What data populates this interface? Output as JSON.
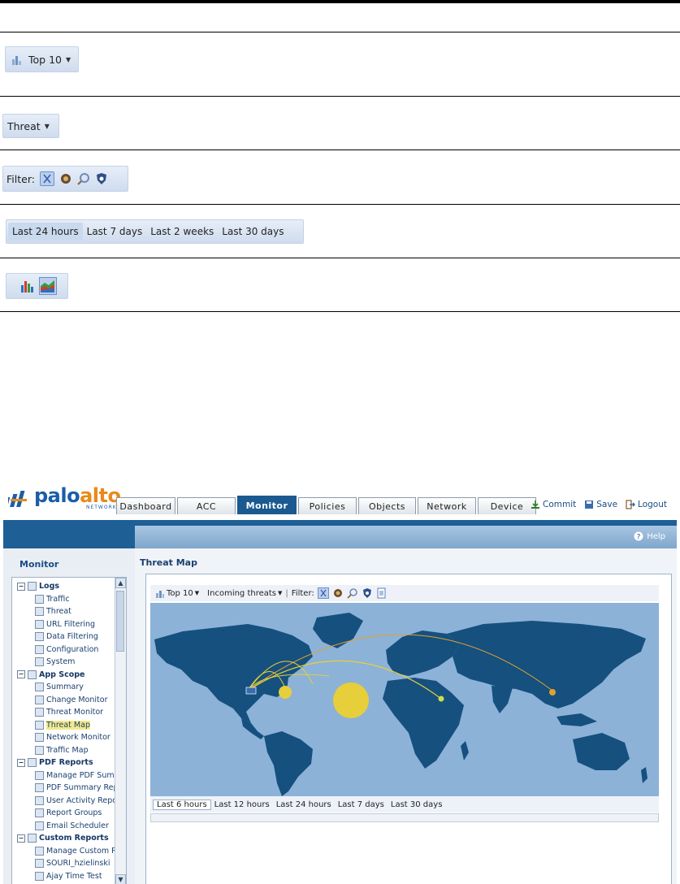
{
  "callouts": {
    "top10": "Top 10",
    "threat": "Threat",
    "filter_label": "Filter:",
    "time_ranges": [
      "Last 24 hours",
      "Last 7 days",
      "Last 2 weeks",
      "Last 30 days"
    ],
    "filter_icons": [
      "filter-x-icon",
      "virus-icon",
      "spyware-icon",
      "vulnerability-icon"
    ],
    "chart_icons": [
      "bar-chart-icon",
      "area-chart-icon"
    ]
  },
  "app": {
    "logo": {
      "part1": "palo",
      "part2": "alto",
      "sub": "NETWORKS"
    },
    "tabs": [
      "Dashboard",
      "ACC",
      "Monitor",
      "Policies",
      "Objects",
      "Network",
      "Device"
    ],
    "active_tab": "Monitor",
    "top_links": {
      "commit": "Commit",
      "save": "Save",
      "logout": "Logout"
    },
    "help": "Help",
    "sidebar_title": "Monitor",
    "content_title": "Threat Map",
    "tree": [
      {
        "label": "Logs",
        "group": true
      },
      {
        "label": "Traffic"
      },
      {
        "label": "Threat"
      },
      {
        "label": "URL Filtering"
      },
      {
        "label": "Data Filtering"
      },
      {
        "label": "Configuration"
      },
      {
        "label": "System"
      },
      {
        "label": "App Scope",
        "group": true
      },
      {
        "label": "Summary"
      },
      {
        "label": "Change Monitor"
      },
      {
        "label": "Threat Monitor"
      },
      {
        "label": "Threat Map",
        "selected": true
      },
      {
        "label": "Network Monitor"
      },
      {
        "label": "Traffic Map"
      },
      {
        "label": "PDF Reports",
        "group": true
      },
      {
        "label": "Manage PDF Sumi"
      },
      {
        "label": "PDF Summary Rep"
      },
      {
        "label": "User Activity Repo"
      },
      {
        "label": "Report Groups"
      },
      {
        "label": "Email Scheduler"
      },
      {
        "label": "Custom Reports",
        "group": true
      },
      {
        "label": "Manage Custom R"
      },
      {
        "label": "SOURI_hzielinski"
      },
      {
        "label": "Ajay Time Test"
      }
    ],
    "map_toolbar": {
      "top10": "Top 10",
      "direction": "Incoming threats",
      "filter": "Filter:"
    },
    "map_time_ranges": [
      "Last 6 hours",
      "Last 12 hours",
      "Last 24 hours",
      "Last 7 days",
      "Last 30 days"
    ],
    "colors": {
      "nav_blue": "#1e5f96",
      "ocean": "#8cb2d8",
      "land": "#15507f",
      "threat_yellow": "#e6cf3a",
      "threat_orange": "#e3a22a"
    }
  }
}
